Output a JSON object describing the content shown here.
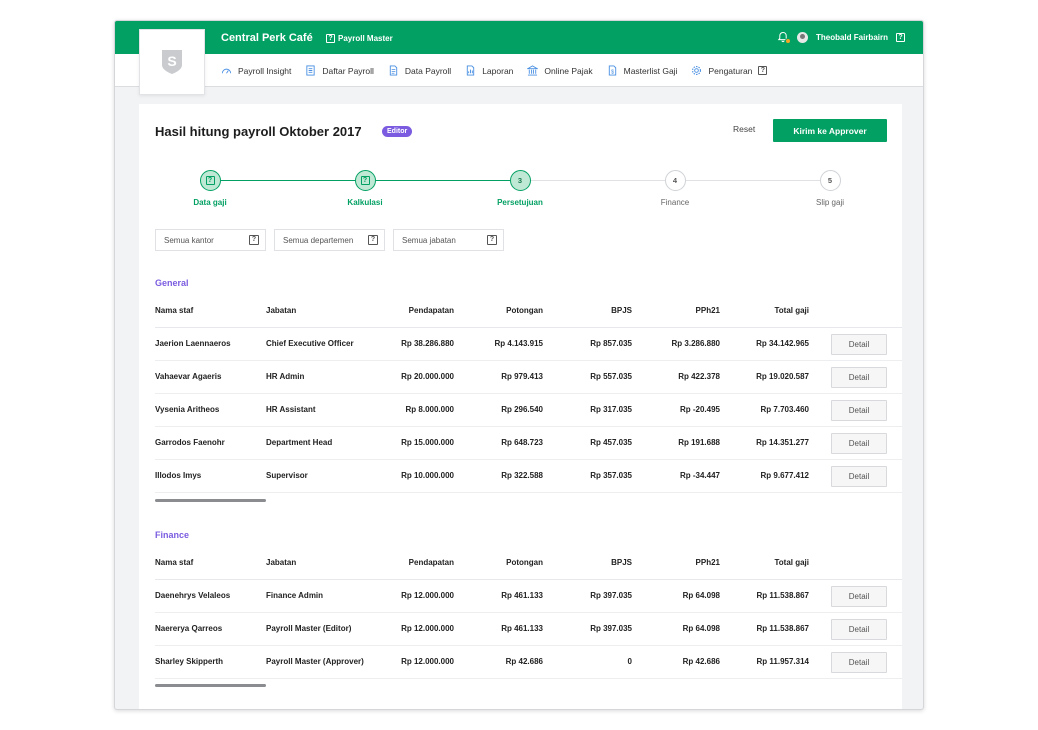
{
  "app": {
    "company": "Central Perk Café",
    "role": "Payroll Master",
    "user": "Theobald Fairbairn",
    "logo_letter": "S"
  },
  "colors": {
    "brand": "#03a063",
    "accent_purple": "#7b5ce0",
    "notification": "#f5a623"
  },
  "nav": [
    {
      "label": "Payroll Insight",
      "icon": "gauge-icon"
    },
    {
      "label": "Daftar Payroll",
      "icon": "list-icon"
    },
    {
      "label": "Data Payroll",
      "icon": "document-icon"
    },
    {
      "label": "Laporan",
      "icon": "report-icon"
    },
    {
      "label": "Online Pajak",
      "icon": "bank-icon"
    },
    {
      "label": "Masterlist Gaji",
      "icon": "masterlist-icon"
    },
    {
      "label": "Pengaturan",
      "icon": "gear-icon"
    }
  ],
  "page": {
    "title": "Hasil hitung payroll Oktober 2017",
    "badge": "Editor",
    "reset_label": "Reset",
    "submit_label": "Kirim ke Approver"
  },
  "steps": [
    {
      "label": "Data gaji",
      "mark": "",
      "state": "done"
    },
    {
      "label": "Kalkulasi",
      "mark": "",
      "state": "done"
    },
    {
      "label": "Persetujuan",
      "mark": "3",
      "state": "current"
    },
    {
      "label": "Finance",
      "mark": "4",
      "state": "todo"
    },
    {
      "label": "Slip gaji",
      "mark": "5",
      "state": "todo"
    }
  ],
  "filters": [
    {
      "label": "Semua kantor"
    },
    {
      "label": "Semua departemen"
    },
    {
      "label": "Semua jabatan"
    }
  ],
  "columns": [
    "Nama staf",
    "Jabatan",
    "Pendapatan",
    "Potongan",
    "BPJS",
    "PPh21",
    "Total gaji"
  ],
  "detail_label": "Detail",
  "sections": [
    {
      "title": "General",
      "rows": [
        {
          "name": "Jaerion Laennaeros",
          "job": "Chief Executive Officer",
          "income": "Rp 38.286.880",
          "deduction": "Rp 4.143.915",
          "bpjs": "Rp 857.035",
          "pph21": "Rp 3.286.880",
          "total": "Rp 34.142.965"
        },
        {
          "name": "Vahaevar Agaeris",
          "job": "HR Admin",
          "income": "Rp 20.000.000",
          "deduction": "Rp 979.413",
          "bpjs": "Rp 557.035",
          "pph21": "Rp 422.378",
          "total": "Rp 19.020.587"
        },
        {
          "name": "Vysenia Aritheos",
          "job": "HR Assistant",
          "income": "Rp 8.000.000",
          "deduction": "Rp 296.540",
          "bpjs": "Rp 317.035",
          "pph21": "Rp -20.495",
          "total": "Rp 7.703.460"
        },
        {
          "name": "Garrodos Faenohr",
          "job": "Department Head",
          "income": "Rp 15.000.000",
          "deduction": "Rp 648.723",
          "bpjs": "Rp 457.035",
          "pph21": "Rp 191.688",
          "total": "Rp 14.351.277"
        },
        {
          "name": "Illodos Imys",
          "job": "Supervisor",
          "income": "Rp 10.000.000",
          "deduction": "Rp 322.588",
          "bpjs": "Rp 357.035",
          "pph21": "Rp -34.447",
          "total": "Rp 9.677.412"
        }
      ]
    },
    {
      "title": "Finance",
      "rows": [
        {
          "name": "Daenehrys Velaleos",
          "job": "Finance Admin",
          "income": "Rp 12.000.000",
          "deduction": "Rp 461.133",
          "bpjs": "Rp 397.035",
          "pph21": "Rp 64.098",
          "total": "Rp 11.538.867"
        },
        {
          "name": "Naererya Qarreos",
          "job": "Payroll Master (Editor)",
          "income": "Rp 12.000.000",
          "deduction": "Rp 461.133",
          "bpjs": "Rp 397.035",
          "pph21": "Rp 64.098",
          "total": "Rp 11.538.867"
        },
        {
          "name": "Sharley Skipperth",
          "job": "Payroll Master (Approver)",
          "income": "Rp 12.000.000",
          "deduction": "Rp 42.686",
          "bpjs": "0",
          "pph21": "Rp 42.686",
          "total": "Rp 11.957.314"
        }
      ]
    }
  ]
}
